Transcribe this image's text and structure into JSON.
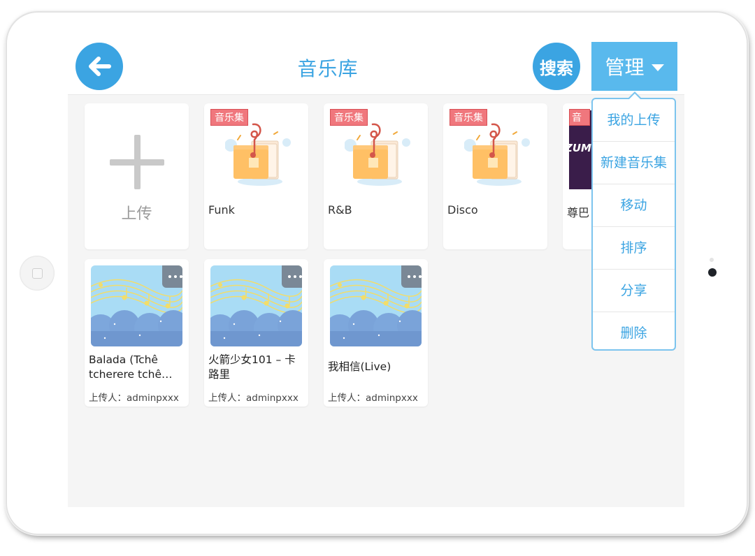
{
  "header": {
    "title": "音乐库",
    "search_label": "搜索",
    "manage_label": "管理"
  },
  "upload_tile": {
    "label": "上传"
  },
  "albums": [
    {
      "badge": "音乐集",
      "name": "Funk"
    },
    {
      "badge": "音乐集",
      "name": "R&B"
    },
    {
      "badge": "音乐集",
      "name": "Disco"
    },
    {
      "badge": "音乐集",
      "name": "尊巴",
      "cover_text": "ZUMBA DANCE"
    }
  ],
  "songs": [
    {
      "title": "Balada (Tchê tcherere tchê…",
      "uploader": "上传人：adminpxxx"
    },
    {
      "title": "火箭少女101 – 卡路里",
      "uploader": "上传人：adminpxxx"
    },
    {
      "title": "我相信(Live)",
      "uploader": "上传人：adminpxxx"
    }
  ],
  "manage_menu": {
    "items": [
      "我的上传",
      "新建音乐集",
      "移动",
      "排序",
      "分享",
      "删除"
    ]
  },
  "colors": {
    "accent": "#3ba4e2",
    "manage_button": "#59b9ed",
    "badge": "#f0777d",
    "background": "#f5f5f5"
  },
  "icons": [
    "back-arrow-icon",
    "plus-icon",
    "caret-down-icon",
    "more-icon",
    "music-folder-icon"
  ]
}
